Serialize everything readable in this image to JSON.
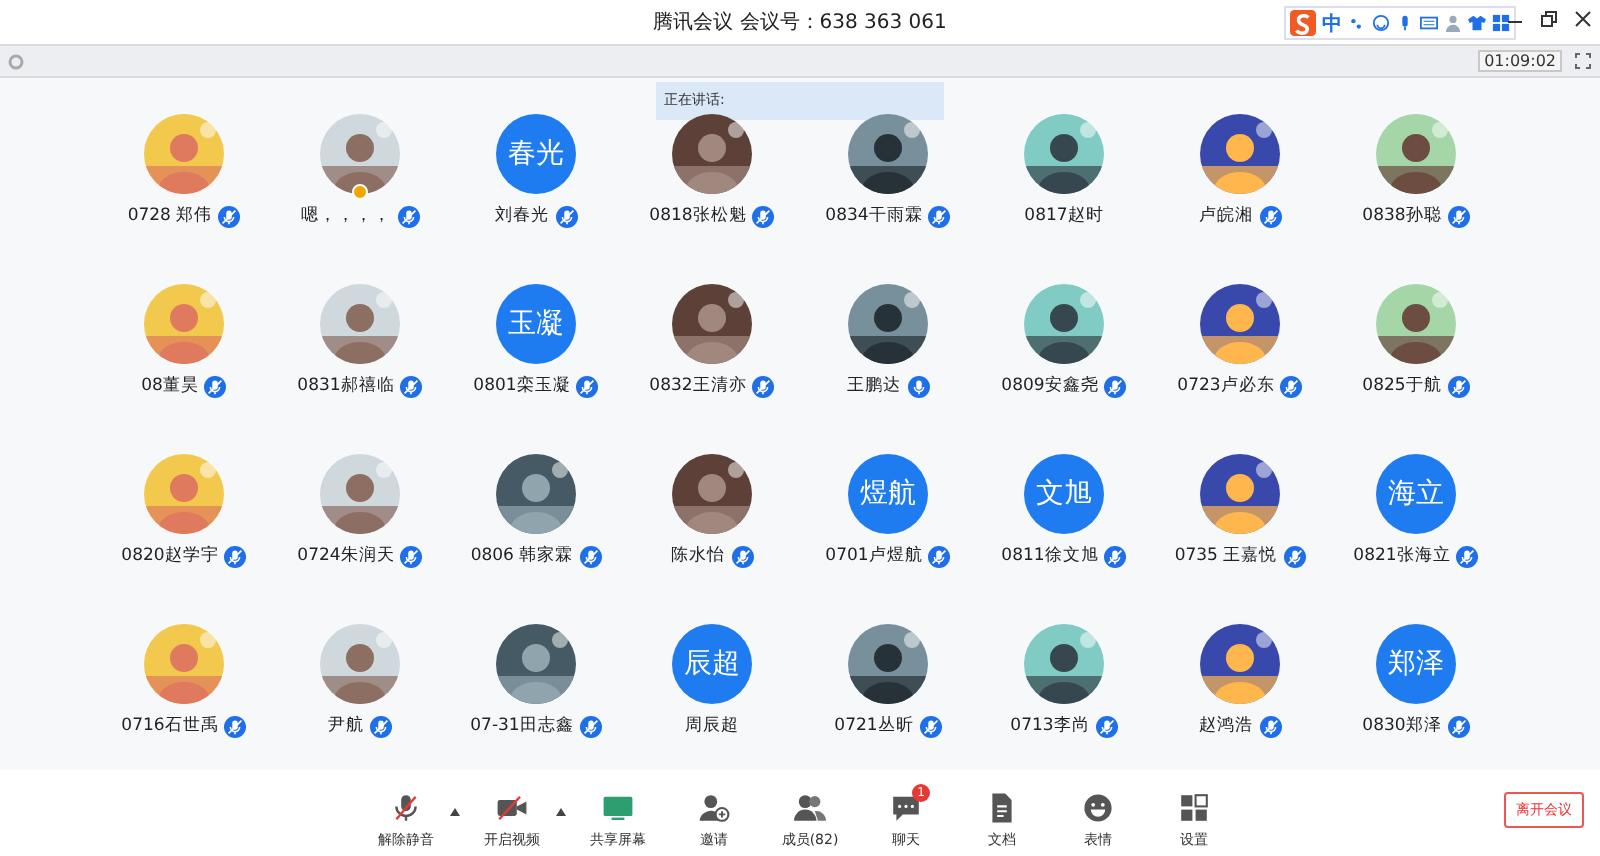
{
  "window": {
    "title": "腾讯会议 会议号：638 363 061"
  },
  "ime_bar": {
    "mode": "中"
  },
  "timer": "01:09:02",
  "speaking_toast": "正在讲话:",
  "participants": [
    {
      "name": "0728 郑伟",
      "muted": true
    },
    {
      "name": "嗯，，，，",
      "muted": true,
      "host": true
    },
    {
      "name": "刘春光",
      "kind": "text",
      "avatar_text": "春光",
      "muted": true
    },
    {
      "name": "0818张松魁",
      "muted": true
    },
    {
      "name": "0834干雨霖",
      "muted": true
    },
    {
      "name": "0817赵时"
    },
    {
      "name": "卢皖湘",
      "muted": true
    },
    {
      "name": "0838孙聪",
      "muted": true
    },
    {
      "name": "08董昊",
      "muted": true
    },
    {
      "name": "0831郝禧临",
      "muted": true
    },
    {
      "name": "0801栾玉凝",
      "kind": "text",
      "avatar_text": "玉凝",
      "muted": true
    },
    {
      "name": "0832王清亦",
      "muted": true
    },
    {
      "name": "王鹏达",
      "muted": false
    },
    {
      "name": "0809安鑫尧",
      "muted": true
    },
    {
      "name": "0723卢必东",
      "muted": true
    },
    {
      "name": "0825于航",
      "muted": true
    },
    {
      "name": "0820赵学宇",
      "muted": true
    },
    {
      "name": "0724朱润天",
      "muted": true
    },
    {
      "name": "0806 韩家霖",
      "muted": true
    },
    {
      "name": "陈水怡",
      "muted": true
    },
    {
      "name": "0701卢煜航",
      "kind": "text",
      "avatar_text": "煜航",
      "muted": true
    },
    {
      "name": "0811徐文旭",
      "kind": "text",
      "avatar_text": "文旭",
      "muted": true
    },
    {
      "name": "0735 王嘉悦",
      "muted": true
    },
    {
      "name": "0821张海立",
      "kind": "text",
      "avatar_text": "海立",
      "muted": true
    },
    {
      "name": "0716石世禹",
      "muted": true
    },
    {
      "name": "尹航",
      "muted": true
    },
    {
      "name": "07-31田志鑫",
      "muted": true
    },
    {
      "name": "周辰超",
      "kind": "text",
      "avatar_text": "辰超"
    },
    {
      "name": "0721丛昕",
      "muted": true
    },
    {
      "name": "0713李尚",
      "muted": true
    },
    {
      "name": "赵鸿浩",
      "muted": true
    },
    {
      "name": "0830郑泽",
      "kind": "text",
      "avatar_text": "郑泽",
      "muted": true
    }
  ],
  "toolbar": [
    {
      "label": "解除静音",
      "kind": "mic",
      "caret": true
    },
    {
      "label": "开启视频",
      "kind": "video",
      "caret": true
    },
    {
      "label": "共享屏幕",
      "kind": "share"
    },
    {
      "label": "邀请",
      "kind": "invite"
    },
    {
      "label": "成员(82)",
      "kind": "members"
    },
    {
      "label": "聊天",
      "kind": "chat",
      "badge": "1"
    },
    {
      "label": "文档",
      "kind": "doc"
    },
    {
      "label": "表情",
      "kind": "emoji"
    },
    {
      "label": "设置",
      "kind": "settings"
    }
  ],
  "leave_button": "离开会议"
}
